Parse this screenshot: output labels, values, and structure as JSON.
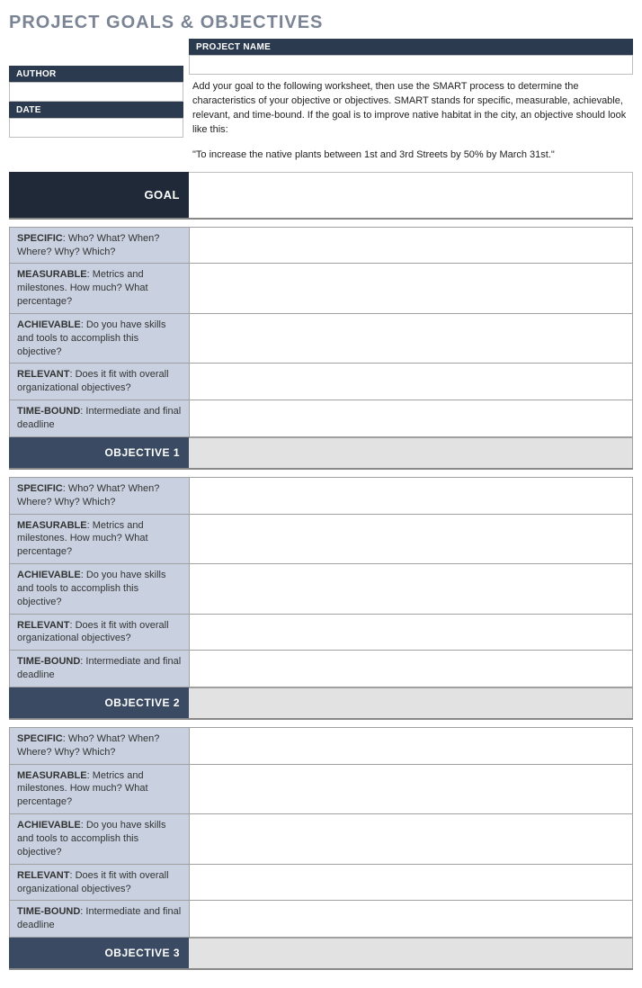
{
  "title": "PROJECT GOALS & OBJECTIVES",
  "header": {
    "project_name_label": "PROJECT NAME",
    "project_name_value": "",
    "author_label": "AUTHOR",
    "author_value": "",
    "date_label": "DATE",
    "date_value": ""
  },
  "description": {
    "p1": "Add your goal to the following worksheet, then use the SMART process to determine the characteristics of your objective or objectives. SMART stands for specific, measurable, achievable, relevant, and time-bound. If the goal is to improve native habitat in the city, an objective should look like this:",
    "p2": "\"To increase the native plants between 1st and 3rd Streets by 50% by March 31st.\""
  },
  "goal_label": "GOAL",
  "goal_value": "",
  "smart": {
    "specific": {
      "key": "SPECIFIC",
      "text": ": Who? What? When? Where? Why? Which?"
    },
    "measurable": {
      "key": "MEASURABLE",
      "text": ": Metrics and milestones. How much? What percentage?"
    },
    "achievable": {
      "key": "ACHIEVABLE",
      "text": ": Do you have skills and tools to accomplish this objective?"
    },
    "relevant": {
      "key": "RELEVANT",
      "text": ": Does it fit with overall organizational objectives?"
    },
    "timebound": {
      "key": "TIME-BOUND",
      "text": ": Intermediate and final deadline"
    }
  },
  "objectives": {
    "o1": {
      "label": "OBJECTIVE 1",
      "value": ""
    },
    "o2": {
      "label": "OBJECTIVE 2",
      "value": ""
    },
    "o3": {
      "label": "OBJECTIVE 3",
      "value": ""
    }
  }
}
